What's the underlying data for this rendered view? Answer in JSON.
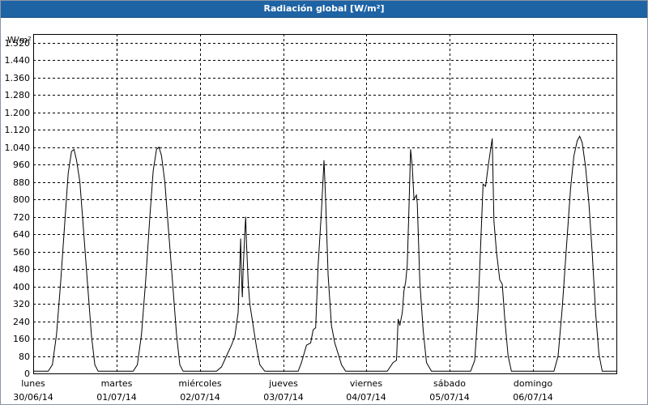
{
  "window": {
    "title": "Radiación global [W/m²]"
  },
  "chart_data": {
    "type": "line",
    "title": "Radiación global [W/m²]",
    "ylabel": "W/m²",
    "ylim": [
      0,
      1560
    ],
    "grid": true,
    "y_ticks": [
      "0",
      "80",
      "160",
      "240",
      "320",
      "400",
      "480",
      "560",
      "640",
      "720",
      "800",
      "880",
      "960",
      "1.040",
      "1.120",
      "1.200",
      "1.280",
      "1.360",
      "1.440",
      "1.520"
    ],
    "y_tick_values": [
      0,
      80,
      160,
      240,
      320,
      400,
      480,
      560,
      640,
      720,
      800,
      880,
      960,
      1040,
      1120,
      1200,
      1280,
      1360,
      1440,
      1520
    ],
    "x_ticks": [
      {
        "day": "lunes",
        "date": "30/06/14"
      },
      {
        "day": "martes",
        "date": "01/07/14"
      },
      {
        "day": "miércoles",
        "date": "02/07/14"
      },
      {
        "day": "jueves",
        "date": "03/07/14"
      },
      {
        "day": "viernes",
        "date": "04/07/14"
      },
      {
        "day": "sábado",
        "date": "05/07/14"
      },
      {
        "day": "domingo",
        "date": "06/07/14"
      }
    ],
    "xlim_days": [
      0,
      7
    ],
    "series": [
      {
        "color": "#000000",
        "points": [
          [
            0.0,
            10
          ],
          [
            0.18,
            10
          ],
          [
            0.23,
            40
          ],
          [
            0.28,
            180
          ],
          [
            0.33,
            420
          ],
          [
            0.38,
            700
          ],
          [
            0.42,
            920
          ],
          [
            0.46,
            1020
          ],
          [
            0.49,
            1030
          ],
          [
            0.52,
            980
          ],
          [
            0.56,
            880
          ],
          [
            0.6,
            680
          ],
          [
            0.65,
            420
          ],
          [
            0.7,
            170
          ],
          [
            0.74,
            40
          ],
          [
            0.78,
            10
          ],
          [
            1.0,
            10
          ],
          [
            1.2,
            10
          ],
          [
            1.25,
            40
          ],
          [
            1.3,
            180
          ],
          [
            1.35,
            430
          ],
          [
            1.4,
            720
          ],
          [
            1.44,
            930
          ],
          [
            1.48,
            1030
          ],
          [
            1.51,
            1040
          ],
          [
            1.54,
            1000
          ],
          [
            1.58,
            880
          ],
          [
            1.62,
            680
          ],
          [
            1.67,
            430
          ],
          [
            1.72,
            180
          ],
          [
            1.76,
            40
          ],
          [
            1.8,
            10
          ],
          [
            2.0,
            10
          ],
          [
            2.2,
            10
          ],
          [
            2.26,
            30
          ],
          [
            2.32,
            80
          ],
          [
            2.38,
            130
          ],
          [
            2.42,
            170
          ],
          [
            2.46,
            280
          ],
          [
            2.48,
            500
          ],
          [
            2.49,
            620
          ],
          [
            2.5,
            450
          ],
          [
            2.51,
            350
          ],
          [
            2.52,
            480
          ],
          [
            2.54,
            650
          ],
          [
            2.55,
            720
          ],
          [
            2.56,
            600
          ],
          [
            2.58,
            420
          ],
          [
            2.6,
            320
          ],
          [
            2.64,
            220
          ],
          [
            2.68,
            120
          ],
          [
            2.72,
            40
          ],
          [
            2.78,
            10
          ],
          [
            3.0,
            10
          ],
          [
            3.18,
            10
          ],
          [
            3.22,
            50
          ],
          [
            3.28,
            130
          ],
          [
            3.33,
            140
          ],
          [
            3.36,
            200
          ],
          [
            3.39,
            210
          ],
          [
            3.42,
            500
          ],
          [
            3.46,
            750
          ],
          [
            3.49,
            980
          ],
          [
            3.51,
            800
          ],
          [
            3.54,
            450
          ],
          [
            3.58,
            220
          ],
          [
            3.62,
            140
          ],
          [
            3.66,
            90
          ],
          [
            3.7,
            40
          ],
          [
            3.75,
            10
          ],
          [
            4.0,
            10
          ],
          [
            4.25,
            10
          ],
          [
            4.32,
            50
          ],
          [
            4.36,
            60
          ],
          [
            4.38,
            250
          ],
          [
            4.4,
            220
          ],
          [
            4.43,
            280
          ],
          [
            4.45,
            380
          ],
          [
            4.47,
            420
          ],
          [
            4.49,
            500
          ],
          [
            4.51,
            760
          ],
          [
            4.53,
            1030
          ],
          [
            4.55,
            950
          ],
          [
            4.57,
            800
          ],
          [
            4.6,
            820
          ],
          [
            4.61,
            780
          ],
          [
            4.64,
            420
          ],
          [
            4.68,
            200
          ],
          [
            4.72,
            50
          ],
          [
            4.78,
            10
          ],
          [
            5.0,
            10
          ],
          [
            5.25,
            10
          ],
          [
            5.3,
            60
          ],
          [
            5.34,
            300
          ],
          [
            5.37,
            580
          ],
          [
            5.4,
            870
          ],
          [
            5.43,
            860
          ],
          [
            5.46,
            950
          ],
          [
            5.49,
            1030
          ],
          [
            5.51,
            1080
          ],
          [
            5.53,
            700
          ],
          [
            5.56,
            560
          ],
          [
            5.6,
            430
          ],
          [
            5.63,
            410
          ],
          [
            5.66,
            250
          ],
          [
            5.7,
            80
          ],
          [
            5.74,
            10
          ],
          [
            6.0,
            10
          ],
          [
            6.25,
            10
          ],
          [
            6.3,
            80
          ],
          [
            6.35,
            300
          ],
          [
            6.4,
            580
          ],
          [
            6.45,
            850
          ],
          [
            6.49,
            1000
          ],
          [
            6.53,
            1070
          ],
          [
            6.56,
            1090
          ],
          [
            6.59,
            1060
          ],
          [
            6.63,
            950
          ],
          [
            6.67,
            780
          ],
          [
            6.71,
            550
          ],
          [
            6.75,
            280
          ],
          [
            6.79,
            90
          ],
          [
            6.83,
            10
          ],
          [
            7.0,
            10
          ]
        ]
      }
    ]
  }
}
